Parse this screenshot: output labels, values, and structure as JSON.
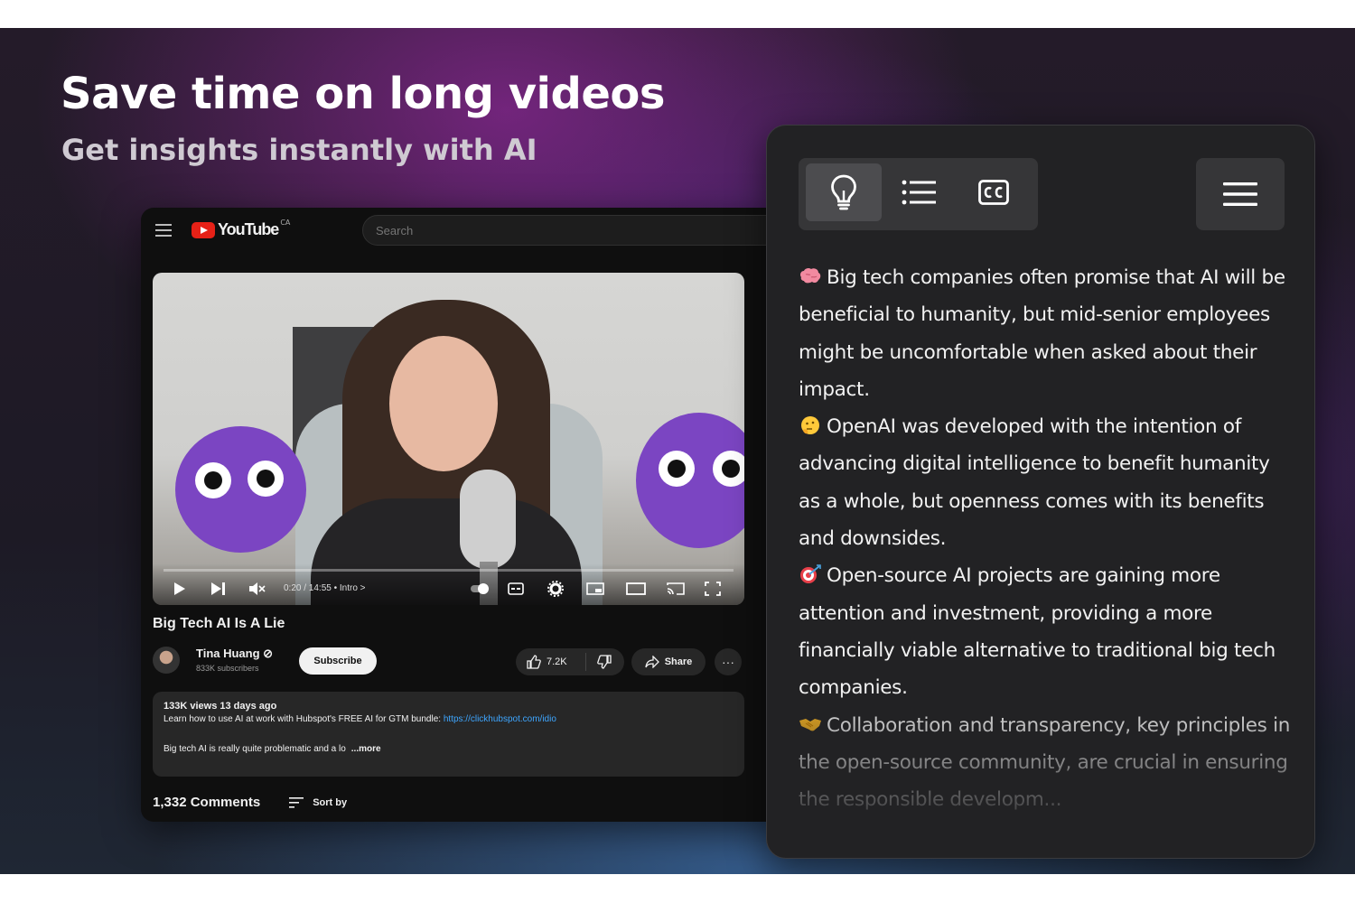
{
  "hero": {
    "headline": "Save time on long videos",
    "subheadline": "Get insights instantly with AI"
  },
  "youtube": {
    "logo_text": "YouTube",
    "logo_region": "CA",
    "search_placeholder": "Search",
    "player": {
      "time_display": "0:20 / 14:55 • Intro >"
    },
    "video_title": "Big Tech AI Is A Lie",
    "channel": {
      "name": "Tina Huang ⊘",
      "subscribers": "833K subscribers",
      "subscribe_label": "Subscribe"
    },
    "actions": {
      "like_count": "7.2K",
      "share_label": "Share",
      "more_label": "···"
    },
    "description": {
      "meta": "133K views 13 days ago",
      "line": "Learn how to use AI at work with Hubspot's FREE AI for GTM bundle: ",
      "link": "https://clickhubspot.com/idio",
      "snippet": "Big tech AI is really quite problematic and a lo",
      "more_label": "...more"
    },
    "comments": {
      "count_label": "1,332 Comments",
      "sort_label": "Sort by"
    }
  },
  "ai_panel": {
    "tabs": [
      {
        "name": "insights",
        "icon": "lightbulb-icon",
        "active": true
      },
      {
        "name": "outline",
        "icon": "list-icon",
        "active": false
      },
      {
        "name": "transcript",
        "icon": "closed-captions-icon",
        "active": false
      }
    ],
    "menu_icon": "hamburger-menu-icon",
    "insights": [
      {
        "emoji": "brain",
        "text": "Big tech companies often promise that AI will be beneficial to humanity, but mid-senior employees might be uncomfortable when asked about their impact."
      },
      {
        "emoji": "thinking-face",
        "text": "OpenAI was developed with the intention of advancing digital intelligence to benefit humanity as a whole, but openness comes with its benefits and downsides."
      },
      {
        "emoji": "direct-hit",
        "text": "Open-source AI projects are gaining more attention and investment, providing a more financially viable alternative to traditional big tech companies."
      },
      {
        "emoji": "handshake",
        "text": "Collaboration and transparency, key principles in the open-source community, are crucial in ensuring the responsible developm..."
      }
    ]
  },
  "colors": {
    "panel_bg": "#222224",
    "panel_button_bg": "#363638",
    "active_tab_bg": "#4c4c4f",
    "text_primary": "#f2f2f2",
    "youtube_red": "#e62117",
    "link_blue": "#3ea6ff"
  }
}
